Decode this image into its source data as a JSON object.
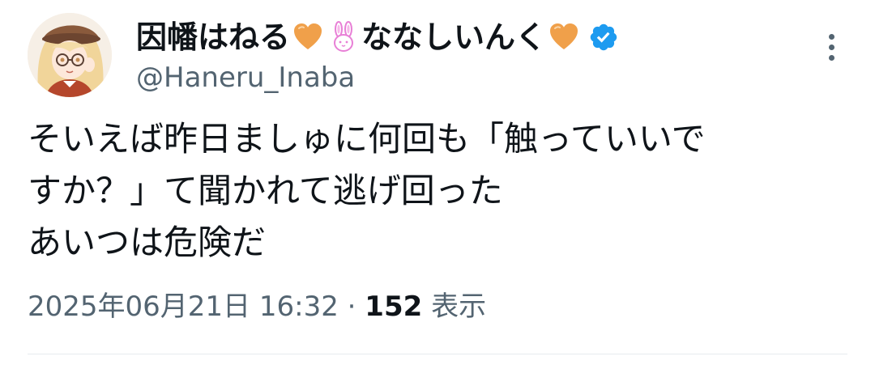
{
  "author": {
    "name_part1": "因幡はねる",
    "name_part2": "ななしいんく",
    "handle": "@Haneru_Inaba",
    "verified": true
  },
  "icons": {
    "heart": "orange-heart-icon",
    "rabbit": "rabbit-face-icon",
    "verified": "verified-badge-icon",
    "more": "more-options-icon"
  },
  "colors": {
    "text": "#0f1419",
    "secondary": "#536471",
    "verified_blue": "#1d9bf0",
    "heart_orange": "#f0a04a",
    "rabbit_pink": "#e87fd6",
    "divider": "#e6ebef"
  },
  "tweet": {
    "lines": [
      "そいえば昨日ましゅに何回も「触っていいで",
      "すか？」て聞かれて逃げ回った",
      "あいつは危険だ"
    ],
    "timestamp": "2025年06月21日 16:32",
    "separator": " · ",
    "views_count": "152",
    "views_label": " 表示"
  }
}
